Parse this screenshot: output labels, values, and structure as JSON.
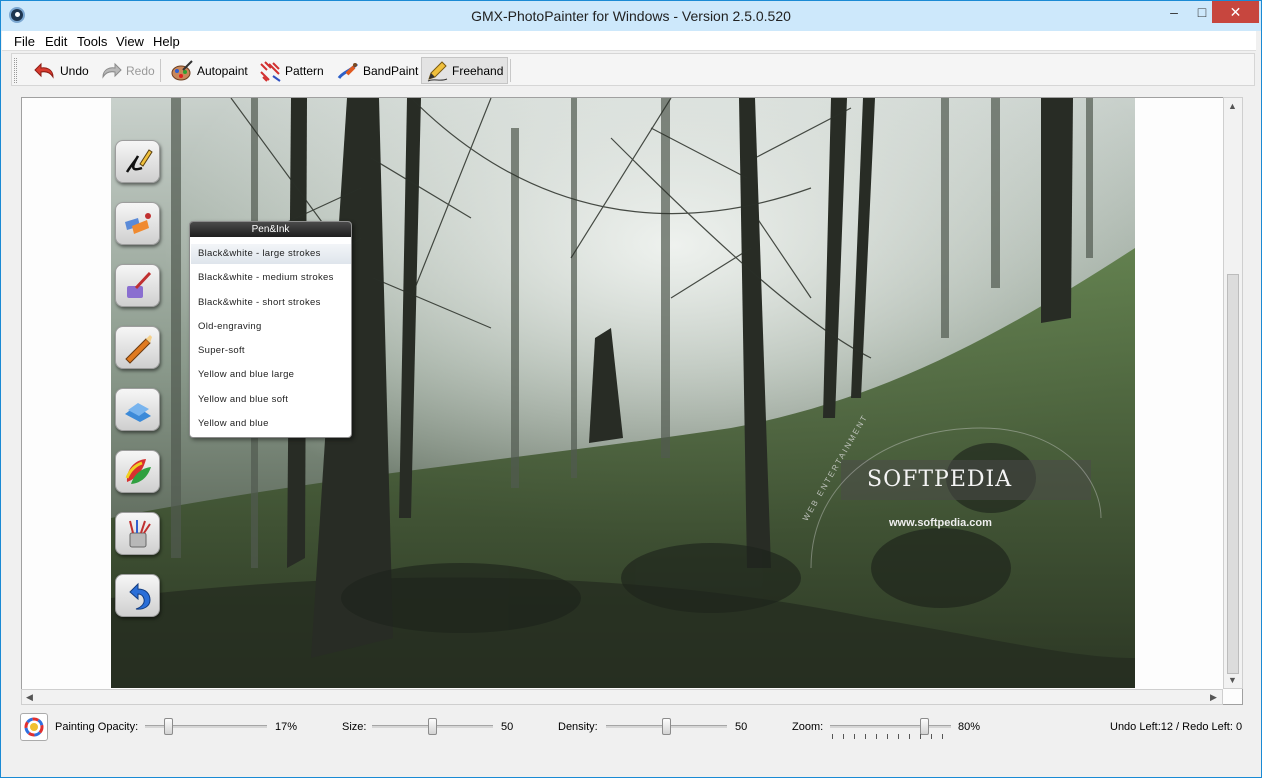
{
  "window": {
    "title": "GMX-PhotoPainter for Windows - Version 2.5.0.520"
  },
  "menu": {
    "file": "File",
    "edit": "Edit",
    "tools": "Tools",
    "view": "View",
    "help": "Help"
  },
  "toolbar": {
    "undo": "Undo",
    "redo": "Redo",
    "autopaint": "Autopaint",
    "pattern": "Pattern",
    "bandpaint": "BandPaint",
    "freehand": "Freehand"
  },
  "popup": {
    "title": "Pen&Ink",
    "items": [
      "Black&white - large strokes",
      "Black&white - medium  strokes",
      "Black&white - short strokes",
      "Old-engraving",
      "Super-soft",
      "Yellow and blue large",
      "Yellow and blue soft",
      "Yellow and blue"
    ],
    "selected_index": 0
  },
  "watermark": {
    "brand": "SOFTPEDIA",
    "url": "www.softpedia.com",
    "tagline": "WEB ENTERTAINMENT"
  },
  "status": {
    "opacity_label": "Painting Opacity:",
    "opacity_value": "17%",
    "opacity_level": 0.17,
    "size_label": "Size:",
    "size_value": "50",
    "size_level": 0.5,
    "density_label": "Density:",
    "density_value": "50",
    "density_level": 0.5,
    "zoom_label": "Zoom:",
    "zoom_value": "80%",
    "zoom_level": 0.8,
    "undo_redo": "Undo Left:12 / Redo Left: 0"
  },
  "colors": {
    "title_bar": "#cde8fb",
    "close_button": "#c7463e",
    "undo_arrow": "#d83b2f"
  }
}
